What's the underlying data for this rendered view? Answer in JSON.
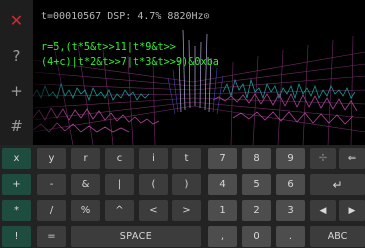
{
  "toolbar": {
    "close_label": "✕",
    "help_label": "?",
    "add_label": "+",
    "hash_label": "#"
  },
  "status": "t=00010567 DSP: 4.7% 8820Hz⊙",
  "code": {
    "line1": "r=5,(t*5&t>>11|t*9&t>>",
    "line2": "(4+c)|t*2&t>>7|t*3&t>>9)&0xba"
  },
  "keyboard": {
    "row1": [
      "x",
      "y",
      "r",
      "c",
      "i",
      "t",
      "7",
      "8",
      "9",
      "✢",
      "⇐"
    ],
    "row2": [
      "+",
      "-",
      "&",
      "|",
      "(",
      ")",
      "4",
      "5",
      "6",
      "↵"
    ],
    "row3": [
      "*",
      "/",
      "%",
      "^",
      "<",
      ">",
      "1",
      "2",
      "3",
      "◀",
      "▶"
    ],
    "row4": [
      "!",
      "=",
      "SPACE",
      ",",
      "0",
      ".",
      "ABC"
    ]
  },
  "colors": {
    "code_text": "#33ee33",
    "close_red": "#d12a2a",
    "key_green": "#1e4d40",
    "wave_cyan": "#1fa8a8",
    "wave_pink": "#c04aa8"
  }
}
